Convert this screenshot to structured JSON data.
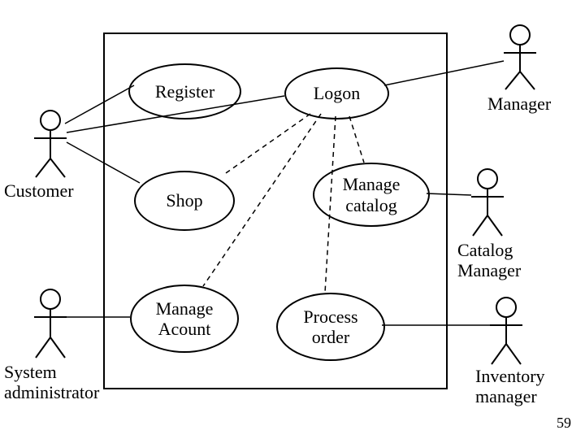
{
  "actors": {
    "customer": "Customer",
    "system_admin": "System\nadministrator",
    "manager": "Manager",
    "catalog_manager": "Catalog\nManager",
    "inventory_manager": "Inventory\nmanager"
  },
  "usecases": {
    "register": "Register",
    "logon": "Logon",
    "shop": "Shop",
    "manage_catalog": "Manage\ncatalog",
    "manage_account": "Manage\nAcount",
    "process_order": "Process\norder"
  },
  "page_number": "59"
}
